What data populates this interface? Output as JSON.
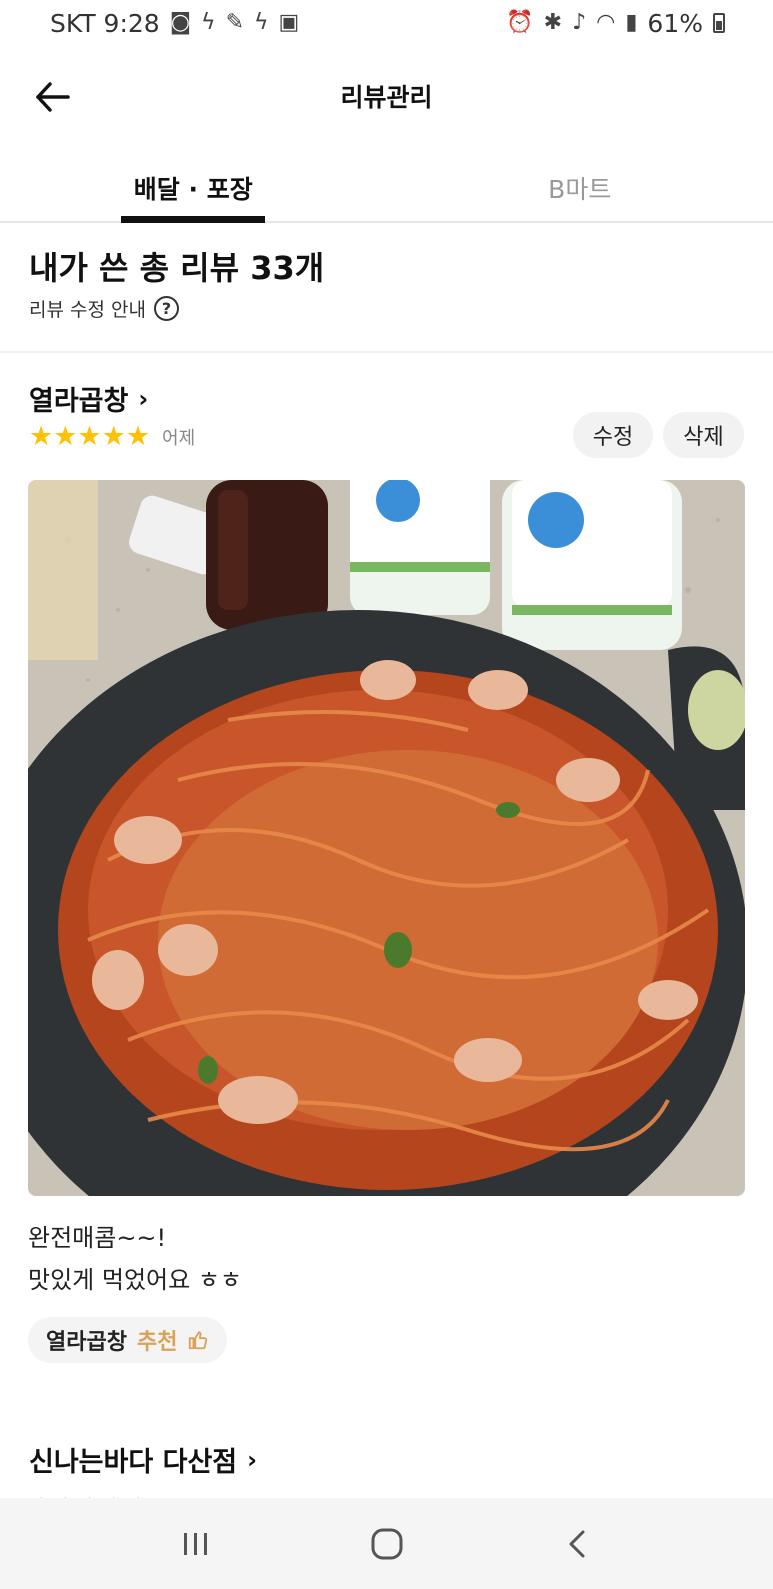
{
  "status_bar": {
    "carrier_time": "SKT 9:28",
    "battery": "61%"
  },
  "header": {
    "title": "리뷰관리"
  },
  "tabs": [
    {
      "label": "배달 · 포장",
      "active": true
    },
    {
      "label": "B마트",
      "active": false
    }
  ],
  "summary": {
    "total_title": "내가 쓴 총 리뷰 33개",
    "edit_guide": "리뷰 수정 안내"
  },
  "review": {
    "store_name": "열라곱창",
    "stars": "★★★★★",
    "rating": 5,
    "date": "어제",
    "edit_label": "수정",
    "delete_label": "삭제",
    "text_line1": "완전매콤~~!",
    "text_line2": "맛있게 먹었어요 ㅎㅎ",
    "recommend_store": "열라곱창",
    "recommend_label": "추천"
  },
  "next_review": {
    "store_name": "신나는바다 다산점",
    "stars": "★★★★★"
  },
  "colors": {
    "star": "#ffc107",
    "recommend": "#d9a256",
    "tab_indicator": "#111111"
  }
}
